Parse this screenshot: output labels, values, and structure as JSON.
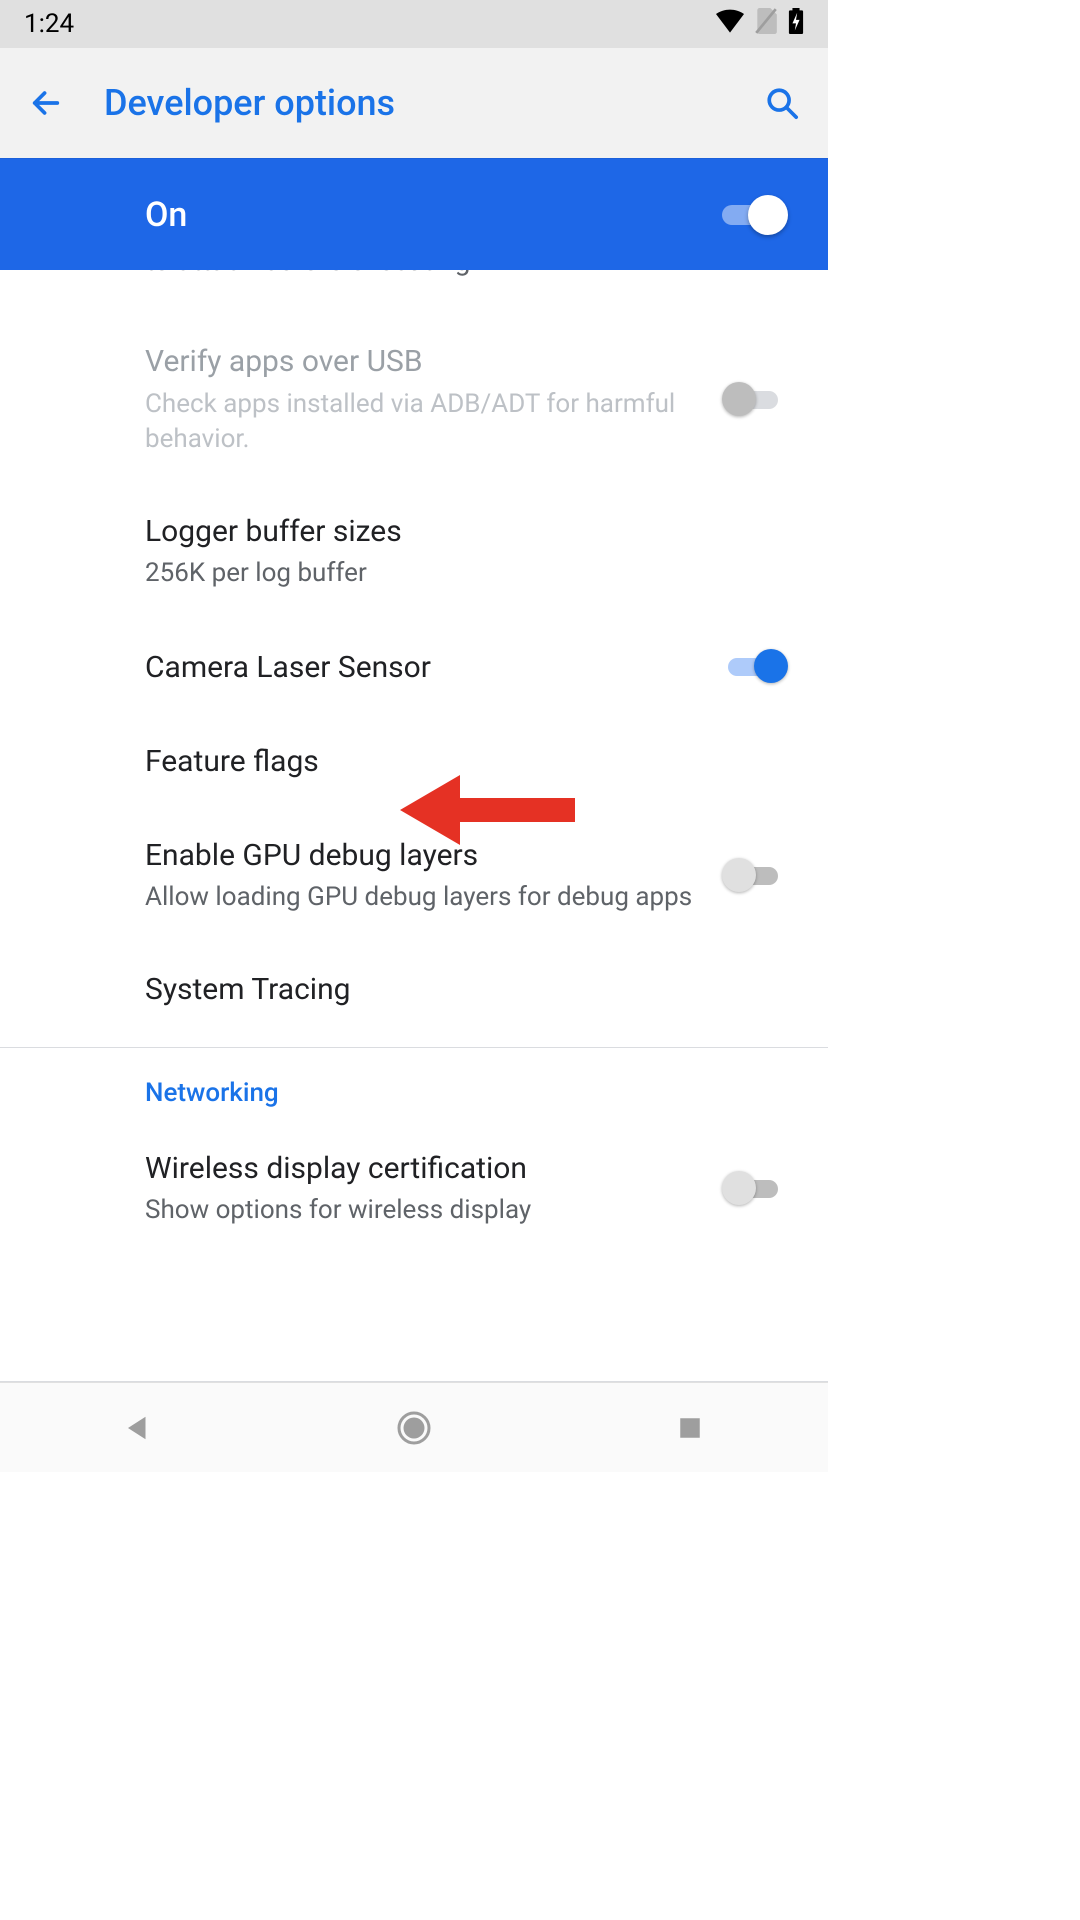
{
  "status": {
    "time": "1:24"
  },
  "header": {
    "title": "Developer options"
  },
  "master": {
    "label": "On",
    "on": true
  },
  "partial_top": "to attach before executing",
  "items": {
    "verify_usb": {
      "title": "Verify apps over USB",
      "subtitle": "Check apps installed via ADB/ADT for harmful behavior."
    },
    "logger": {
      "title": "Logger buffer sizes",
      "subtitle": "256K per log buffer"
    },
    "camera_laser": {
      "title": "Camera Laser Sensor"
    },
    "feature_flags": {
      "title": "Feature flags"
    },
    "gpu_debug": {
      "title": "Enable GPU debug layers",
      "subtitle": "Allow loading GPU debug layers for debug apps"
    },
    "system_tracing": {
      "title": "System Tracing"
    },
    "wireless_cert": {
      "title": "Wireless display certification",
      "subtitle": "Show options for wireless display"
    }
  },
  "sections": {
    "networking": "Networking"
  }
}
